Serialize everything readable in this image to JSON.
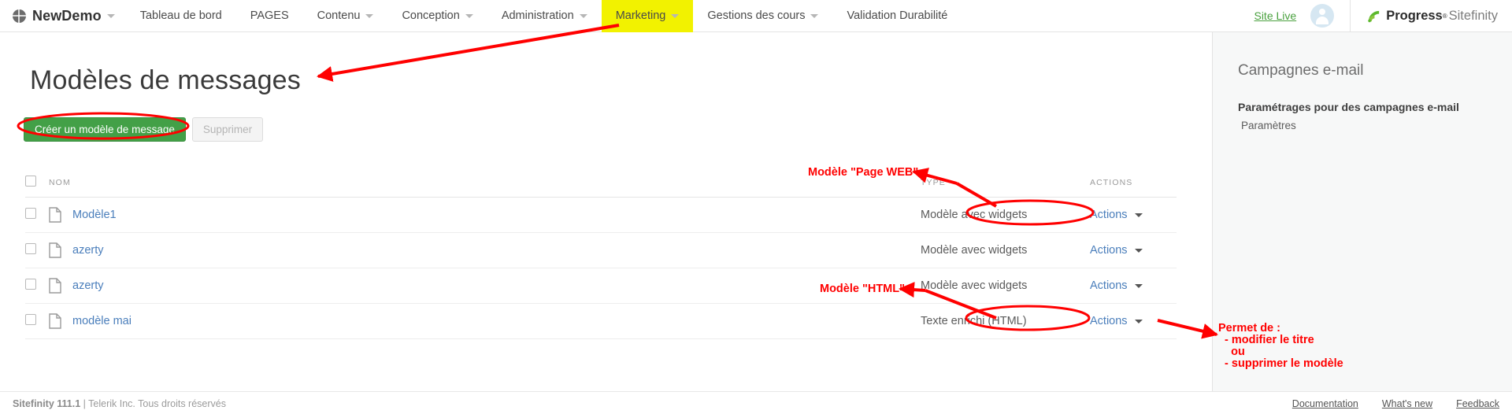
{
  "topnav": {
    "brand": {
      "label": "NewDemo",
      "icon": "globe-icon"
    },
    "items": [
      {
        "label": "Tableau de bord",
        "has_caret": false,
        "highlighted": false
      },
      {
        "label": "PAGES",
        "has_caret": false,
        "highlighted": false
      },
      {
        "label": "Contenu",
        "has_caret": true,
        "highlighted": false
      },
      {
        "label": "Conception",
        "has_caret": true,
        "highlighted": false
      },
      {
        "label": "Administration",
        "has_caret": true,
        "highlighted": false
      },
      {
        "label": "Marketing",
        "has_caret": true,
        "highlighted": true
      },
      {
        "label": "Gestions des cours",
        "has_caret": true,
        "highlighted": false
      },
      {
        "label": "Validation Durabilité",
        "has_caret": false,
        "highlighted": false
      }
    ],
    "site_live": "Site Live",
    "avatar_icon": "user-avatar-icon",
    "logo": {
      "brand": "Progress",
      "suffix": "Sitefinity",
      "mark_icon": "sitefinity-mark-icon"
    }
  },
  "main": {
    "page_title": "Modèles de messages",
    "create_button": "Créer un modèle de message",
    "delete_button": "Supprimer",
    "table": {
      "columns": [
        "NOM",
        "TYPE",
        "ACTIONS"
      ],
      "rows": [
        {
          "name": "Modèle1",
          "type": "Modèle avec widgets",
          "action": "Actions"
        },
        {
          "name": "azerty",
          "type": "Modèle avec widgets",
          "action": "Actions"
        },
        {
          "name": "azerty",
          "type": "Modèle avec widgets",
          "action": "Actions"
        },
        {
          "name": "modèle mai",
          "type": "Texte enrichi (HTML)",
          "action": "Actions"
        }
      ]
    }
  },
  "rightpanel": {
    "title": "Campagnes e-mail",
    "subtitle": "Paramétrages pour des campagnes e-mail",
    "link": "Paramètres"
  },
  "footer": {
    "copyright_bold": "Sitefinity 111.1",
    "copyright_rest": " | Telerik Inc. Tous droits réservés",
    "links": [
      "Documentation",
      "What's new",
      "Feedback"
    ]
  },
  "annotations": {
    "color": "#ff0000",
    "page_web": "Modèle \"Page WEB\"",
    "html": "Modèle \"HTML\"",
    "permet": "Permet de :\n  - modifier le titre\n    ou\n  - supprimer le modèle"
  },
  "colors": {
    "accent_green": "#43a047",
    "link_blue": "#4a7ebb",
    "highlight_yellow": "#f2f200",
    "annotation_red": "#ff0000"
  }
}
